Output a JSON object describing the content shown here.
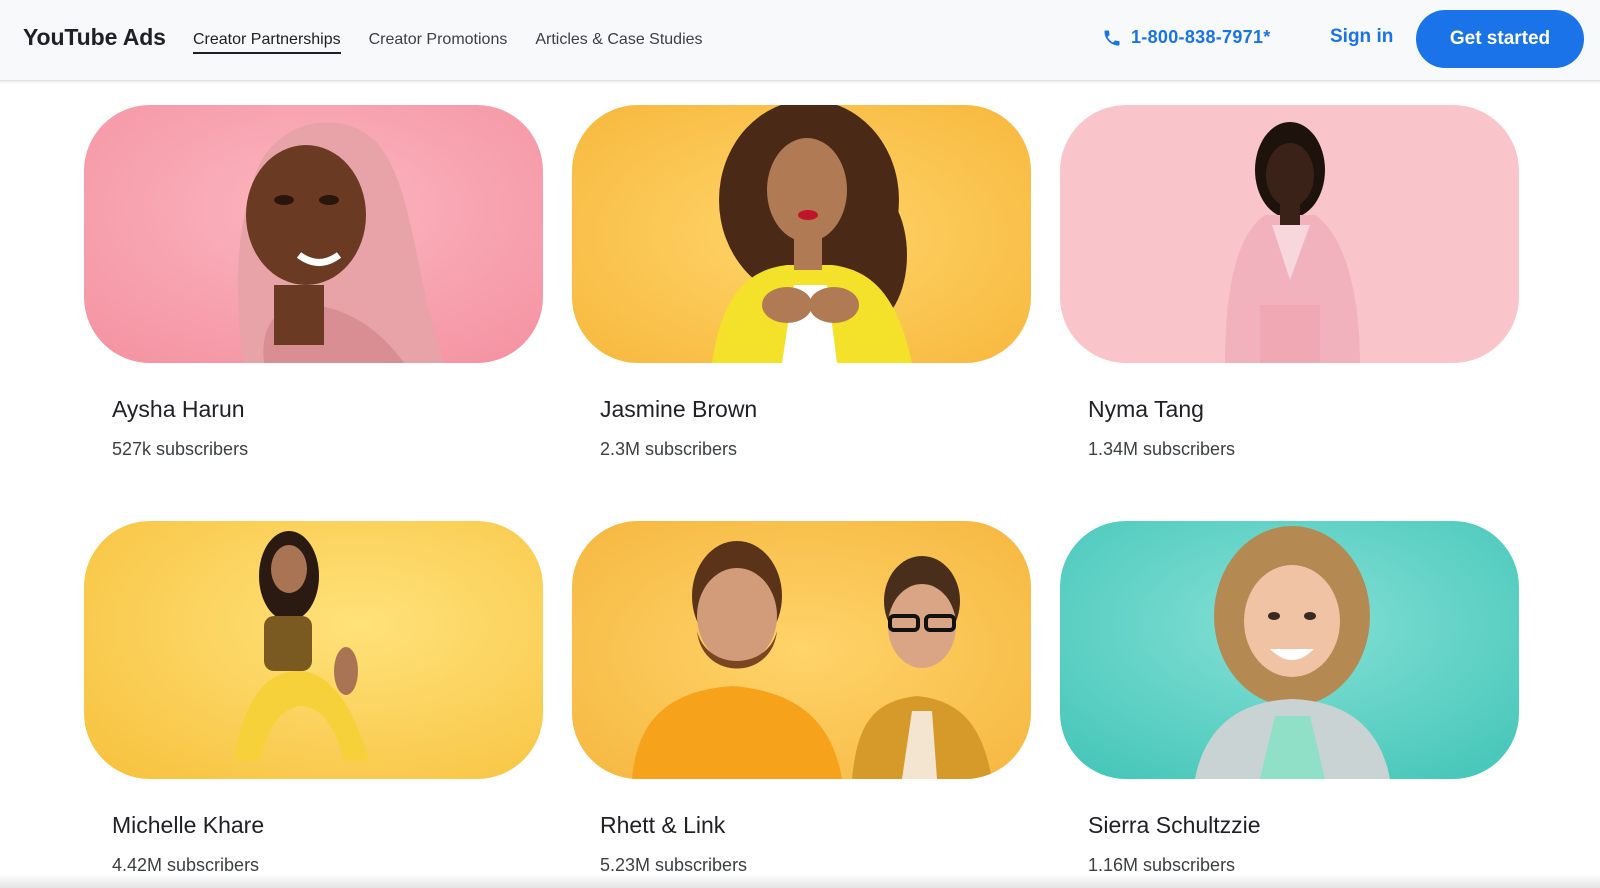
{
  "header": {
    "logo": "YouTube Ads",
    "tabs": [
      {
        "label": "Creator Partnerships",
        "active": true
      },
      {
        "label": "Creator Promotions",
        "active": false
      },
      {
        "label": "Articles & Case Studies",
        "active": false
      }
    ],
    "phone": "1-800-838-7971*",
    "signin": "Sign in",
    "cta": "Get started"
  },
  "colors": {
    "accent": "#1a73e8",
    "pink_bg": "#f7a9b4",
    "yellow_bg": "#fbc351",
    "light_pink_bg": "#f9c5cb",
    "teal_bg": "#5fd3c8"
  },
  "creators": [
    {
      "name": "Aysha Harun",
      "subscribers": "527k subscribers",
      "background": "pink"
    },
    {
      "name": "Jasmine Brown",
      "subscribers": "2.3M subscribers",
      "background": "yellow"
    },
    {
      "name": "Nyma Tang",
      "subscribers": "1.34M subscribers",
      "background": "light-pink"
    },
    {
      "name": "Michelle Khare",
      "subscribers": "4.42M subscribers",
      "background": "yellow"
    },
    {
      "name": "Rhett & Link",
      "subscribers": "5.23M subscribers",
      "background": "yellow"
    },
    {
      "name": "Sierra Schultzzie",
      "subscribers": "1.16M subscribers",
      "background": "teal"
    }
  ]
}
